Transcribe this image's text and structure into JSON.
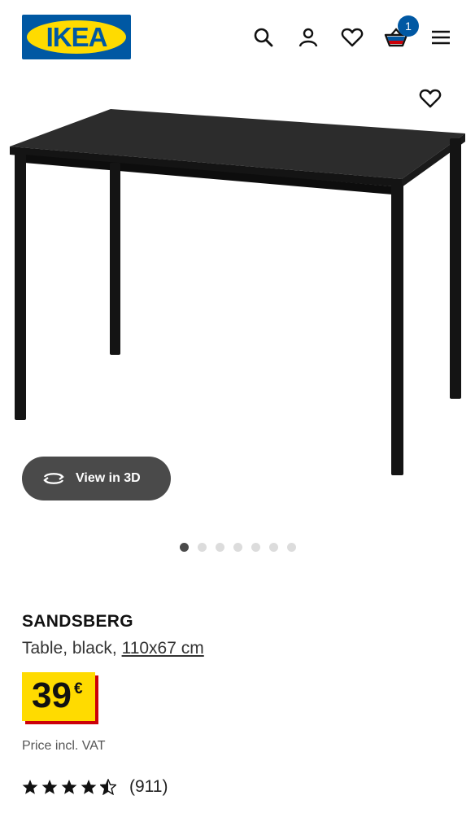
{
  "header": {
    "logo_text": "IKEA",
    "icons": [
      "search-icon",
      "user-icon",
      "heart-icon",
      "basket-icon",
      "menu-icon"
    ],
    "basket_count": "1",
    "brand_blue": "#0058A3",
    "brand_yellow": "#FFDB00"
  },
  "gallery": {
    "view3d_label": "View in 3D",
    "total_images": 7,
    "active_index": 0
  },
  "product": {
    "name": "SANDSBERG",
    "description": "Table, black, ",
    "size_link": "110x67 cm",
    "price": "39",
    "currency": "€",
    "vat_note": "Price incl. VAT",
    "rating_stars": 4.5,
    "review_count": "(911)",
    "price_bg": "#FFDB00",
    "price_shadow": "#CC0008"
  }
}
